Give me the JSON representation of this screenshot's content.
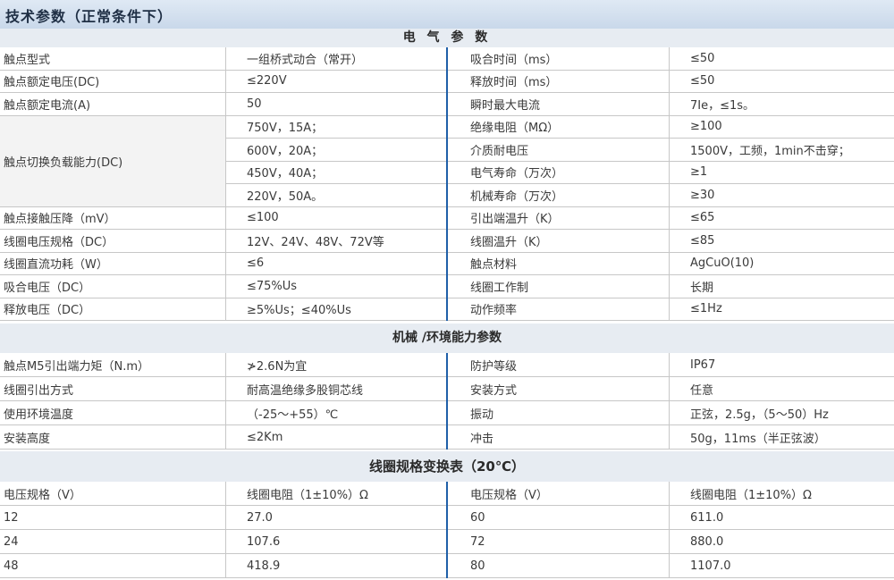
{
  "title": "技术参数（正常条件下）",
  "electrical": {
    "header": "电 气 参 数",
    "rows": [
      {
        "a": "触点型式",
        "b": "一组桥式动合（常开）",
        "c": "吸合时间（ms）",
        "d": "≤50"
      },
      {
        "a": "触点额定电压(DC)",
        "b": "≤220V",
        "c": "释放时间（ms）",
        "d": "≤50"
      },
      {
        "a": "触点额定电流(A)",
        "b": "50",
        "c": "瞬时最大电流",
        "d": "7Ie，≤1s。"
      },
      {
        "a": "",
        "b": "750V，15A；",
        "c": "绝缘电阻（MΩ）",
        "d": "≥100"
      },
      {
        "a": "",
        "b": "600V，20A；",
        "c": "介质耐电压",
        "d": "1500V，工频，1min不击穿；"
      },
      {
        "a": "",
        "b": "450V，40A；",
        "c": "电气寿命（万次）",
        "d": "≥1"
      },
      {
        "a": "",
        "b": "220V，50A。",
        "c": "机械寿命（万次）",
        "d": "≥30"
      },
      {
        "a": "触点接触压降（mV）",
        "b": "≤100",
        "c": "引出端温升（K）",
        "d": "≤65"
      },
      {
        "a": "线圈电压规格（DC）",
        "b": "12V、24V、48V、72V等",
        "c": "线圈温升（K）",
        "d": "≤85"
      },
      {
        "a": "线圈直流功耗（W）",
        "b": "≤6",
        "c": "触点材料",
        "d": "AgCuO(10)"
      },
      {
        "a": "吸合电压（DC）",
        "b": "≤75%Us",
        "c": "线圈工作制",
        "d": "长期"
      },
      {
        "a": "释放电压（DC）",
        "b": "≥5%Us；≤40%Us",
        "c": "动作频率",
        "d": "≤1Hz"
      }
    ],
    "merged_label": "触点切换负载能力(DC)"
  },
  "mechanical": {
    "header": "机械 /环境能力参数",
    "rows": [
      {
        "a": "触点M5引出端力矩（N.m）",
        "b": "≯2.6N为宜",
        "c": "防护等级",
        "d": "IP67"
      },
      {
        "a": "线圈引出方式",
        "b": "耐高温绝缘多股铜芯线",
        "c": "安装方式",
        "d": "任意"
      },
      {
        "a": "使用环境温度",
        "b": "（-25～+55）℃",
        "c": "振动",
        "d": "正弦，2.5g，（5～50）Hz"
      },
      {
        "a": "安装高度",
        "b": "≤2Km",
        "c": "冲击",
        "d": "50g，11ms（半正弦波）"
      }
    ]
  },
  "coil": {
    "header": "线圈规格变换表（20℃）",
    "rows": [
      {
        "a": "电压规格（V）",
        "b": "线圈电阻（1±10%）Ω",
        "c": "电压规格（V）",
        "d": "线圈电阻（1±10%）Ω"
      },
      {
        "a": "12",
        "b": "27.0",
        "c": "60",
        "d": "611.0"
      },
      {
        "a": "24",
        "b": "107.6",
        "c": "72",
        "d": "880.0"
      },
      {
        "a": "48",
        "b": "418.9",
        "c": "80",
        "d": "1107.0"
      }
    ]
  },
  "colors": {
    "accent_line": "#1f5fa8",
    "header_bg": "#e7ecf2",
    "title_bg": "#cfdcec"
  }
}
